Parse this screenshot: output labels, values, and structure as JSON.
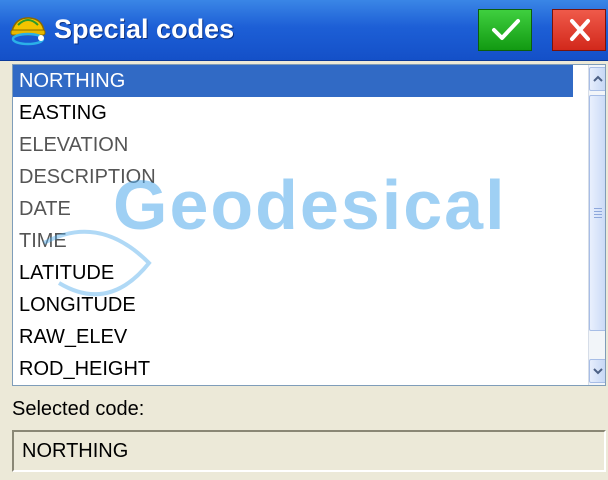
{
  "window": {
    "title": "Special codes",
    "app_icon": "satellite-helmet-icon",
    "ok_icon": "checkmark-icon",
    "close_icon": "close-icon"
  },
  "list": {
    "items": [
      {
        "label": "NORTHING",
        "selected": true
      },
      {
        "label": "EASTING"
      },
      {
        "label": "ELEVATION"
      },
      {
        "label": "DESCRIPTION"
      },
      {
        "label": "DATE"
      },
      {
        "label": "TIME"
      },
      {
        "label": "LATITUDE"
      },
      {
        "label": "LONGITUDE"
      },
      {
        "label": "RAW_ELEV"
      },
      {
        "label": "ROD_HEIGHT"
      }
    ]
  },
  "watermark": {
    "text": "Geodesical"
  },
  "selected_code": {
    "label": "Selected code:",
    "value": "NORTHING"
  },
  "colors": {
    "titlebar": "#1d5fd6",
    "selection": "#316ac5",
    "ok_button": "#1fae1f",
    "close_button": "#e0392b",
    "background": "#ece9d8"
  }
}
